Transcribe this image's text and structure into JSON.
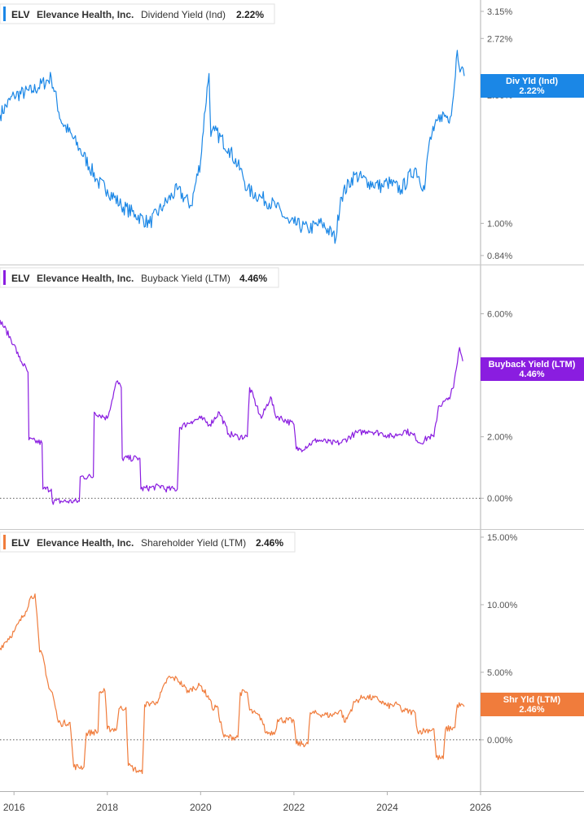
{
  "ticker": "ELV",
  "company": "Elevance Health, Inc.",
  "x_axis_labels": [
    "2016",
    "2018",
    "2020",
    "2022",
    "2024",
    "2026"
  ],
  "colors": {
    "dividend": "#1b87e6",
    "buyback": "#8a1de0",
    "shareholder": "#f07c3c",
    "axis": "#b0b0b0",
    "zero_line": "#555555"
  },
  "chart_data": [
    {
      "type": "line",
      "metric_label": "Dividend Yield (Ind)",
      "legend_value": "2.22%",
      "flag_label": "Div Yld (Ind)",
      "flag_value": "2.22%",
      "y_scale": "log",
      "ylim": [
        0.8,
        3.35
      ],
      "y_ticks": [
        0.84,
        1.0,
        2.0,
        2.72,
        3.15
      ],
      "y_tick_labels": [
        "0.84%",
        "1.00%",
        "2.00%",
        "2.72%",
        "3.15%"
      ],
      "series": [
        {
          "x": [
            2015.7,
            2016.0,
            2016.4,
            2016.8,
            2017.0,
            2017.4,
            2017.8,
            2018.0,
            2018.3,
            2018.6,
            2018.9,
            2019.2,
            2019.5,
            2019.8,
            2020.0,
            2020.18,
            2020.22,
            2020.3,
            2020.6,
            2020.9,
            2021.0,
            2021.3,
            2021.6,
            2021.9,
            2022.0,
            2022.3,
            2022.6,
            2022.9,
            2023.0,
            2023.3,
            2023.6,
            2023.9,
            2024.0,
            2024.3,
            2024.6,
            2024.8,
            2024.9,
            2025.0,
            2025.15,
            2025.35,
            2025.42,
            2025.5,
            2025.58,
            2025.65
          ],
          "values": [
            1.8,
            2.0,
            2.05,
            2.2,
            1.75,
            1.5,
            1.25,
            1.2,
            1.1,
            1.05,
            1.0,
            1.1,
            1.2,
            1.1,
            1.4,
            2.25,
            1.6,
            1.65,
            1.5,
            1.3,
            1.2,
            1.15,
            1.1,
            1.0,
            1.0,
            0.97,
            1.0,
            0.92,
            1.15,
            1.3,
            1.25,
            1.22,
            1.25,
            1.2,
            1.35,
            1.2,
            1.55,
            1.65,
            1.8,
            1.78,
            2.0,
            2.55,
            2.3,
            2.22
          ]
        }
      ]
    },
    {
      "type": "line",
      "metric_label": "Buyback Yield (LTM)",
      "legend_value": "4.46%",
      "flag_label": "Buyback Yield (LTM)",
      "flag_value": "4.46%",
      "ylim": [
        -1.0,
        7.6
      ],
      "y_ticks": [
        0,
        2,
        4,
        6
      ],
      "y_tick_labels": [
        "0.00%",
        "2.00%",
        "4.00%",
        "6.00%"
      ],
      "series": [
        {
          "x": [
            2015.7,
            2016.0,
            2016.1,
            2016.3,
            2016.32,
            2016.6,
            2016.62,
            2016.8,
            2016.82,
            2017.4,
            2017.42,
            2017.7,
            2017.72,
            2018.0,
            2018.2,
            2018.3,
            2018.32,
            2018.7,
            2018.72,
            2019.2,
            2019.22,
            2019.5,
            2019.55,
            2019.8,
            2020.0,
            2020.2,
            2020.4,
            2020.6,
            2020.8,
            2021.0,
            2021.05,
            2021.2,
            2021.3,
            2021.5,
            2021.6,
            2022.0,
            2022.05,
            2022.15,
            2022.5,
            2022.8,
            2023.0,
            2023.3,
            2023.6,
            2023.9,
            2024.1,
            2024.4,
            2024.6,
            2024.7,
            2024.9,
            2025.0,
            2025.1,
            2025.3,
            2025.42,
            2025.48,
            2025.55,
            2025.62
          ],
          "values": [
            5.8,
            5.0,
            4.6,
            4.1,
            1.9,
            1.8,
            0.3,
            0.3,
            -0.1,
            -0.1,
            0.7,
            0.7,
            2.8,
            2.6,
            3.8,
            3.6,
            1.3,
            1.3,
            0.3,
            0.4,
            0.3,
            0.3,
            2.3,
            2.5,
            2.6,
            2.4,
            2.8,
            2.1,
            2.0,
            2.0,
            3.6,
            3.0,
            2.6,
            3.3,
            2.7,
            2.4,
            1.6,
            1.6,
            1.9,
            1.8,
            1.8,
            2.1,
            2.2,
            2.1,
            2.0,
            2.2,
            2.0,
            1.8,
            2.0,
            2.0,
            3.0,
            3.2,
            3.6,
            4.2,
            4.9,
            4.46
          ]
        }
      ]
    },
    {
      "type": "line",
      "metric_label": "Shareholder Yield (LTM)",
      "legend_value": "2.46%",
      "flag_label": "Shr Yld (LTM)",
      "flag_value": "2.46%",
      "ylim": [
        -3.8,
        15.6
      ],
      "y_ticks": [
        0,
        5,
        10,
        15
      ],
      "y_tick_labels": [
        "0.00%",
        "5.00%",
        "10.00%",
        "15.00%"
      ],
      "series": [
        {
          "x": [
            2015.7,
            2016.0,
            2016.25,
            2016.35,
            2016.45,
            2016.55,
            2016.62,
            2016.75,
            2016.82,
            2016.95,
            2017.0,
            2017.2,
            2017.28,
            2017.5,
            2017.55,
            2017.8,
            2017.83,
            2017.95,
            2018.0,
            2018.2,
            2018.25,
            2018.4,
            2018.45,
            2018.75,
            2018.8,
            2019.05,
            2019.1,
            2019.3,
            2019.5,
            2019.75,
            2019.8,
            2020.0,
            2020.2,
            2020.25,
            2020.35,
            2020.5,
            2020.8,
            2020.85,
            2021.0,
            2021.05,
            2021.3,
            2021.4,
            2021.6,
            2021.65,
            2022.0,
            2022.05,
            2022.3,
            2022.35,
            2022.8,
            2023.0,
            2023.1,
            2023.3,
            2023.5,
            2023.8,
            2024.0,
            2024.25,
            2024.3,
            2024.6,
            2024.65,
            2025.0,
            2025.05,
            2025.2,
            2025.25,
            2025.45,
            2025.5,
            2025.65
          ],
          "values": [
            6.8,
            8.0,
            9.5,
            10.5,
            10.8,
            6.5,
            6.2,
            3.8,
            3.5,
            1.3,
            1.2,
            1.3,
            -2.0,
            -2.0,
            0.5,
            0.6,
            3.5,
            3.6,
            0.8,
            0.8,
            2.3,
            2.4,
            -1.9,
            -2.5,
            2.6,
            2.8,
            3.0,
            4.6,
            4.5,
            3.5,
            3.8,
            4.0,
            3.0,
            2.3,
            2.5,
            0.2,
            0.2,
            3.5,
            3.5,
            2.2,
            1.6,
            0.5,
            0.6,
            1.5,
            1.4,
            -0.3,
            -0.3,
            2.0,
            1.8,
            2.2,
            1.3,
            2.8,
            3.2,
            3.0,
            2.5,
            2.6,
            2.2,
            2.0,
            0.6,
            0.8,
            -1.3,
            -1.4,
            0.8,
            0.9,
            2.6,
            2.46
          ]
        }
      ]
    }
  ]
}
